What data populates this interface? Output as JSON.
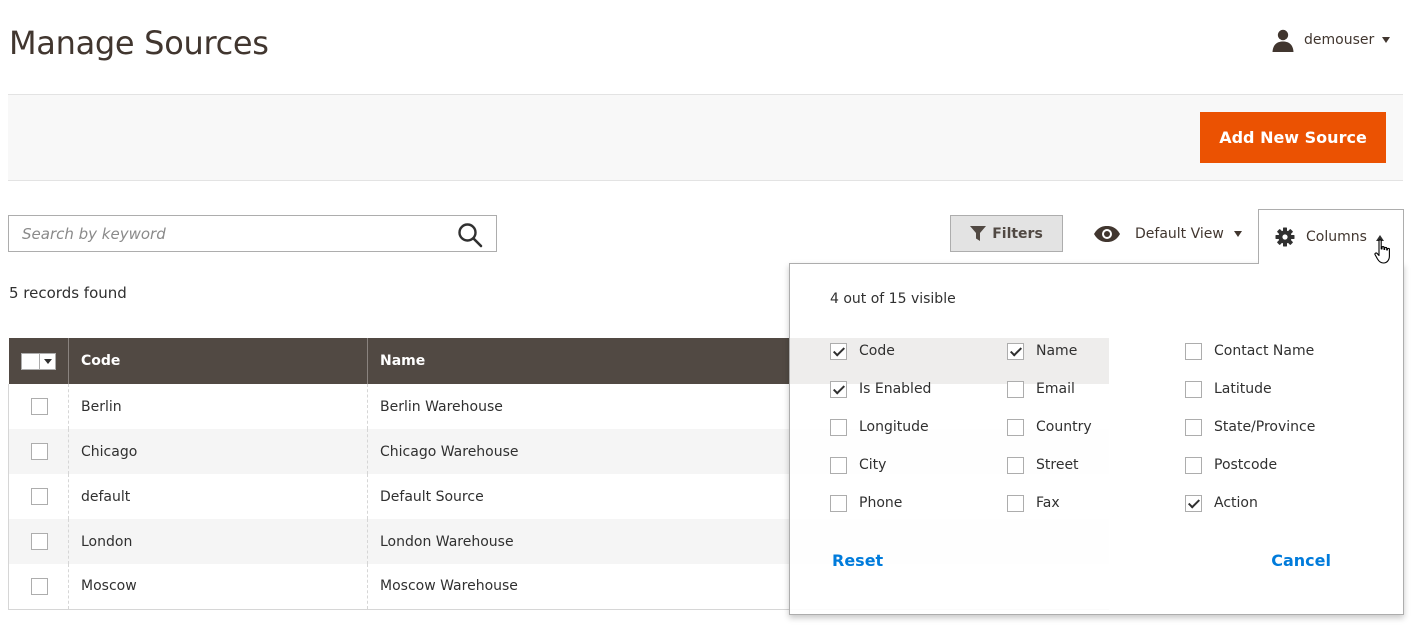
{
  "header": {
    "title": "Manage Sources",
    "username": "demouser"
  },
  "actions": {
    "add_label": "Add New Source"
  },
  "search": {
    "placeholder": "Search by keyword"
  },
  "toolbar": {
    "filters_label": "Filters",
    "view_label": "Default View",
    "columns_label": "Columns"
  },
  "records_found": "5 records found",
  "grid": {
    "headers": [
      "Code",
      "Name"
    ],
    "rows": [
      {
        "code": "Berlin",
        "name": "Berlin Warehouse"
      },
      {
        "code": "Chicago",
        "name": "Chicago Warehouse"
      },
      {
        "code": "default",
        "name": "Default Source"
      },
      {
        "code": "London",
        "name": "London Warehouse"
      },
      {
        "code": "Moscow",
        "name": "Moscow Warehouse"
      }
    ]
  },
  "columns_panel": {
    "visible_count": "4 out of 15 visible",
    "options": [
      {
        "label": "Code",
        "checked": true
      },
      {
        "label": "Name",
        "checked": true
      },
      {
        "label": "Contact Name",
        "checked": false
      },
      {
        "label": "Is Enabled",
        "checked": true
      },
      {
        "label": "Email",
        "checked": false
      },
      {
        "label": "Latitude",
        "checked": false
      },
      {
        "label": "Longitude",
        "checked": false
      },
      {
        "label": "Country",
        "checked": false
      },
      {
        "label": "State/Province",
        "checked": false
      },
      {
        "label": "City",
        "checked": false
      },
      {
        "label": "Street",
        "checked": false
      },
      {
        "label": "Postcode",
        "checked": false
      },
      {
        "label": "Phone",
        "checked": false
      },
      {
        "label": "Fax",
        "checked": false
      },
      {
        "label": "Action",
        "checked": true
      }
    ],
    "reset_label": "Reset",
    "cancel_label": "Cancel"
  },
  "colors": {
    "accent": "#eb5202",
    "grid_header": "#514943",
    "link": "#007bdb"
  }
}
